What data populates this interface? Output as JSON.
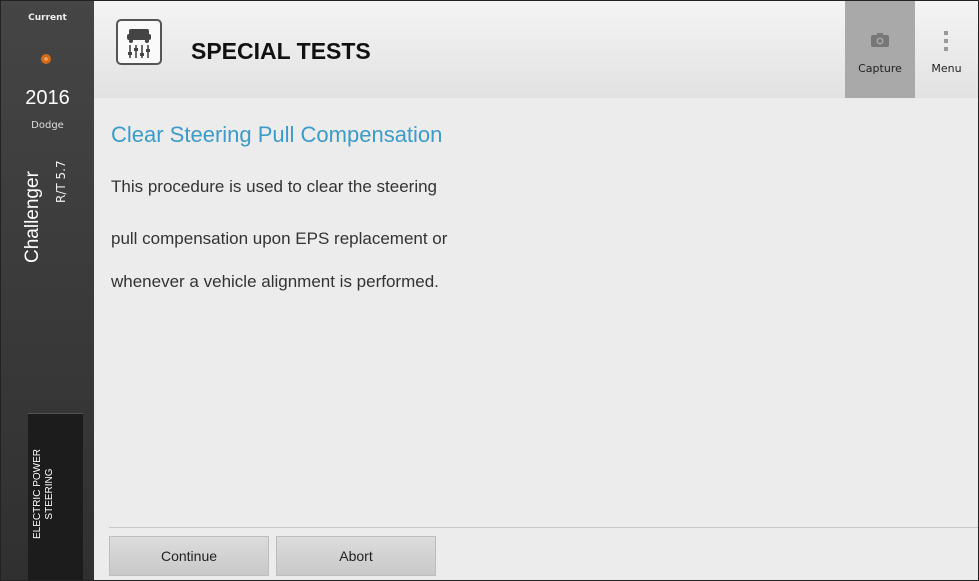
{
  "vehicle": {
    "status_label": "Current",
    "year": "2016",
    "make": "Dodge",
    "model": "Challenger",
    "trim": "R/T 5.7",
    "module": "ELECTRIC POWER STEERING"
  },
  "header": {
    "title": "SPECIAL TESTS",
    "capture_label": "Capture",
    "menu_label": "Menu"
  },
  "content": {
    "heading": "Clear Steering Pull Compensation",
    "lines": [
      "This procedure is used to clear the steering",
      "pull compensation upon EPS replacement or",
      "whenever a vehicle alignment is performed."
    ]
  },
  "footer": {
    "continue_label": "Continue",
    "abort_label": "Abort"
  },
  "colors": {
    "heading": "#3b9bc9",
    "status_dot": "#d26b18",
    "capture_active": "#a9a9a9"
  }
}
